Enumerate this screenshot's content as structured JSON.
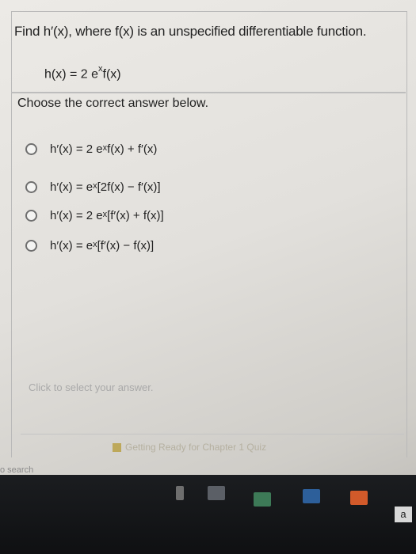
{
  "question": {
    "prompt": "Find h′(x), where f(x) is an unspecified differentiable function.",
    "function_def": {
      "lhs": "h(x) = 2 e",
      "exponent": "x",
      "rhs": "f(x)"
    }
  },
  "answer_prompt": "Choose the correct answer below.",
  "options": [
    {
      "lhs": "h′(x) = 2 e",
      "exponent": "x",
      "rhs": "f(x) + f′(x)"
    },
    {
      "lhs": "h′(x) = e",
      "exponent": "x",
      "rhs": "[2f(x) − f′(x)]"
    },
    {
      "lhs": "h′(x) = 2 e",
      "exponent": "x",
      "rhs": "[f′(x) + f(x)]"
    },
    {
      "lhs": "h′(x) = e",
      "exponent": "x",
      "rhs": "[f′(x) − f(x)]"
    }
  ],
  "hint": "Click to select your answer.",
  "chapter_link": "Getting Ready for Chapter 1 Quiz",
  "search_placeholder": "o search",
  "taskbar": {
    "tray_label": "a"
  }
}
